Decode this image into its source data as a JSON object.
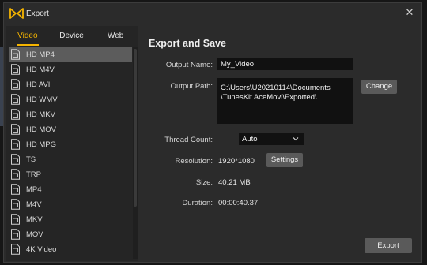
{
  "window": {
    "title": "Export"
  },
  "tabs": [
    {
      "label": "Video",
      "active": true
    },
    {
      "label": "Device",
      "active": false
    },
    {
      "label": "Web",
      "active": false
    }
  ],
  "formats": [
    {
      "label": "HD MP4",
      "selected": true
    },
    {
      "label": "HD M4V"
    },
    {
      "label": "HD AVI"
    },
    {
      "label": "HD WMV"
    },
    {
      "label": "HD MKV"
    },
    {
      "label": "HD MOV"
    },
    {
      "label": "HD MPG"
    },
    {
      "label": "TS"
    },
    {
      "label": "TRP"
    },
    {
      "label": "MP4"
    },
    {
      "label": "M4V"
    },
    {
      "label": "MKV"
    },
    {
      "label": "MOV"
    },
    {
      "label": "4K Video"
    }
  ],
  "panel": {
    "heading": "Export and Save",
    "output_name_label": "Output Name:",
    "output_name_value": "My_Video",
    "output_path_label": "Output Path:",
    "output_path_line1": "C:\\Users\\U20210114\\Documents",
    "output_path_line2": "\\TunesKit AceMovi\\Exported\\",
    "change_label": "Change",
    "thread_count_label": "Thread Count:",
    "thread_count_value": "Auto",
    "resolution_label": "Resolution:",
    "resolution_value": "1920*1080",
    "settings_label": "Settings",
    "size_label": "Size:",
    "size_value": "40.21 MB",
    "duration_label": "Duration:",
    "duration_value": "00:00:40.37",
    "export_label": "Export"
  },
  "colors": {
    "accent": "#f5b400",
    "selected_row": "#5c5c5c",
    "dialog_bg": "#2b2b2b",
    "field_bg": "#111111"
  }
}
